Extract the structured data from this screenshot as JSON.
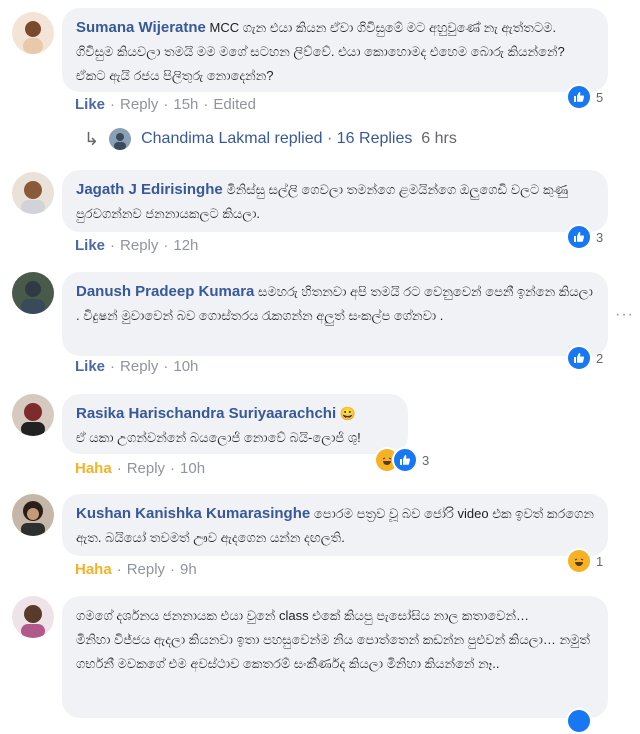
{
  "comments": [
    {
      "author": "Sumana Wijeratne",
      "text": "MCC ගැන එයා කියන ඒවා ගිවිසුමේ මට අහුවුණේ නැ ඇත්තටම. ගිවිසුම කියවලා තමයි මම මගේ සටහන ලිව්වේ. එයා කොහොමද එහෙම බොරු කියන්නේ? ඒකට ඇයි රජය පිලිතුරු නොදෙන්න?",
      "like": "Like",
      "reply": "Reply",
      "time": "15h",
      "edited": "Edited",
      "reaction_count": "5"
    },
    {
      "author": "Jagath J Edirisinghe",
      "text": "මිනිස්සු සල්ලි ගෙවලා තමන්ගෙ ළමයින්ගෙ ඔලුගෙඩි වලට කුණු පුරවගන්නව ජනනායකලට කියලා.",
      "like": "Like",
      "reply": "Reply",
      "time": "12h",
      "reaction_count": "3"
    },
    {
      "author": "Danush Pradeep Kumara",
      "text": "සමහරු හිතනවා අපි තමයි රට වෙනුවෙන් පෙනී ඉන්නෙ කියලා . විදුෂන් මුවාවෙන් බව ගොස්තරය රැකගන්න අලුත් සංකල්ප ගේනවා .",
      "like": "Like",
      "reply": "Reply",
      "time": "10h",
      "reaction_count": "2"
    },
    {
      "author": "Rasika Harischandra Suriyaarachchi",
      "emoji": "😀",
      "text": "ඒ යකා උගන්වන්නේ බයලොජි නොවේ බයි-ලොජි ශු!",
      "like": "Haha",
      "reply": "Reply",
      "time": "10h",
      "reaction_count": "3"
    },
    {
      "author": "Kushan Kanishka Kumarasinghe",
      "text": "පොරම පත්‍රව වූ බව ජෝරි video එක ඉවත් කරගෙන ඇත. බයියෝ තවමත් ඌව ඇදගෙන යන්න දඟලති.",
      "like": "Haha",
      "reply": "Reply",
      "time": "9h",
      "reaction_count": "1"
    },
    {
      "author": "",
      "text1": "ගමගේ දර්ශනය ජනනායක එයා වුනේ class එකේ කියපු පැසෝසිය නාල කතාවෙන්…",
      "text2": "මිනිහා විජ්ජය ඇදලා කියනවා ඉතා පහසුවෙන්ම නිය පොත්තෙන් කඩන්න පුළුවන් කියලා… නමුත් ගර්භනී මවකගේ එම අවස්ථාව කෙතරම් සංකීර්ණද කියලා මිනිහා කියන්නේ නෑ.."
    }
  ],
  "reply_thread": {
    "name": "Chandima Lakmal",
    "replied": "replied",
    "dot": "·",
    "count": "16 Replies",
    "time": "6 hrs"
  },
  "icons": {
    "like": "thumbs-up-icon",
    "haha": "laughing-face-icon",
    "more": "more-options-icon"
  },
  "colors": {
    "author": "#385898",
    "like": "#4b69a6",
    "haha": "#f7b125",
    "bubble": "#f0f2f5"
  }
}
